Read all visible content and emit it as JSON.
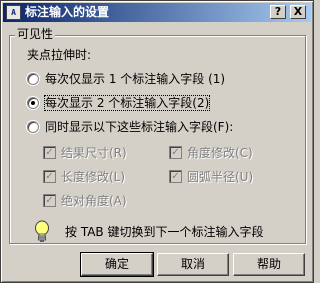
{
  "window": {
    "title": "标注输入的设置",
    "app_icon_text": "A",
    "help_button": "?",
    "close_button": "X"
  },
  "group": {
    "title": "可见性",
    "grip_label": "夹点拉伸时:"
  },
  "options": [
    {
      "label": "每次仅显示 1 个标注输入字段 (1)",
      "selected": false
    },
    {
      "label": "每次显示 2 个标注输入字段(2)",
      "selected": true
    },
    {
      "label": "同时显示以下这些标注输入字段(F):",
      "selected": false
    }
  ],
  "checkboxes": [
    {
      "label": "结果尺寸(R)",
      "checked": true,
      "enabled": false
    },
    {
      "label": "角度修改(C)",
      "checked": true,
      "enabled": false
    },
    {
      "label": "长度修改(L)",
      "checked": true,
      "enabled": false
    },
    {
      "label": "圆弧半径(U)",
      "checked": true,
      "enabled": false
    },
    {
      "label": "绝对角度(A)",
      "checked": true,
      "enabled": false
    }
  ],
  "tip": {
    "icon": "lightbulb-icon",
    "text": "按 TAB 键切换到下一个标注输入字段"
  },
  "buttons": {
    "ok": "确定",
    "cancel": "取消",
    "help": "帮助"
  },
  "colors": {
    "title_start": "#0a246a",
    "title_end": "#a6caf0",
    "face": "#d4d0c8"
  }
}
